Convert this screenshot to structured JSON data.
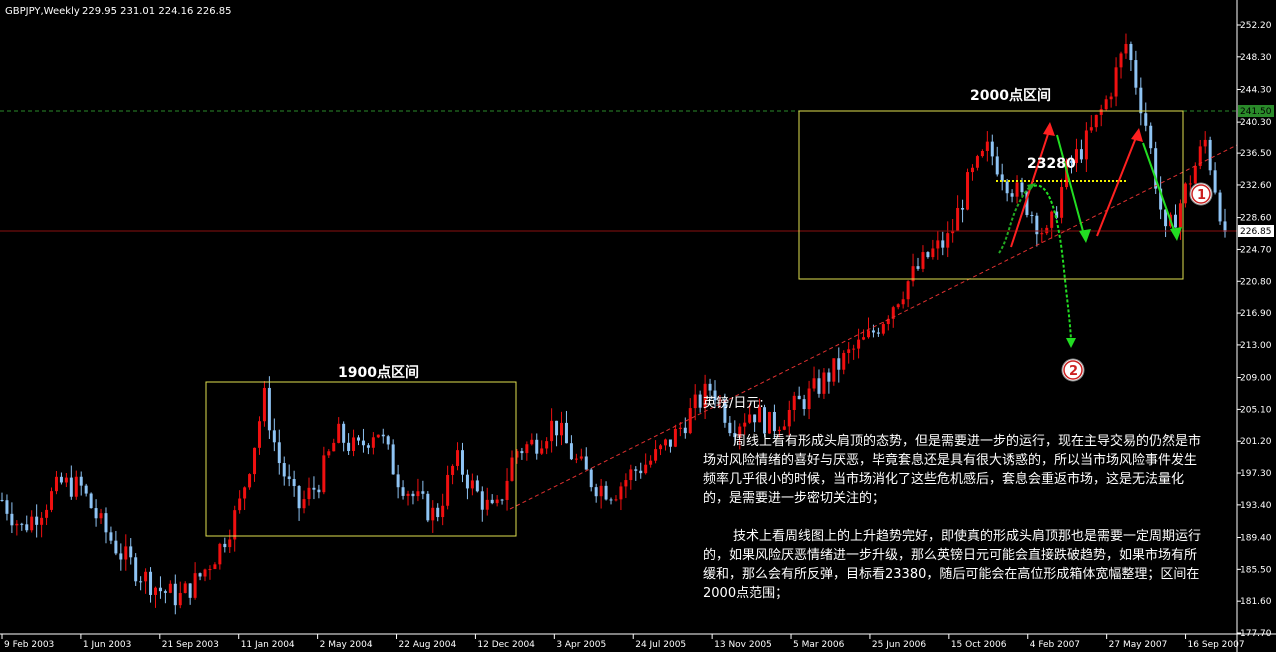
{
  "header": {
    "symbol": "GBPJPY,Weekly",
    "ohlc": "229.95 231.01 224.16 226.85"
  },
  "chart_data": {
    "type": "candlestick",
    "title": "GBPJPY,Weekly",
    "ylim": [
      177.7,
      252.2
    ],
    "y_ticks": [
      "252.20",
      "248.30",
      "244.30",
      "240.30",
      "236.50",
      "232.60",
      "228.60",
      "224.70",
      "220.80",
      "216.90",
      "213.00",
      "209.00",
      "205.10",
      "201.20",
      "197.30",
      "193.40",
      "189.40",
      "185.50",
      "181.60",
      "177.70"
    ],
    "x_ticks": [
      "9 Feb 2003",
      "1 Jun 2003",
      "21 Sep 2003",
      "11 Jan 2004",
      "2 May 2004",
      "22 Aug 2004",
      "12 Dec 2004",
      "3 Apr 2005",
      "24 Jul 2005",
      "13 Nov 2005",
      "5 Mar 2006",
      "25 Jun 2006",
      "15 Oct 2006",
      "4 Feb 2007",
      "27 May 2007",
      "16 Sep 2007"
    ],
    "x_start": "2003-02-09",
    "x_end": "2007-11-11",
    "current_price": {
      "label": "226.85",
      "value": 226.85
    },
    "marked_level": {
      "label": "241.50",
      "value": 241.5
    },
    "close_path": [
      [
        "2003-02-09",
        194.0
      ],
      [
        "2003-03-09",
        190.5
      ],
      [
        "2003-04-06",
        193.0
      ],
      [
        "2003-05-04",
        196.0
      ],
      [
        "2003-06-01",
        195.5
      ],
      [
        "2003-06-29",
        191.0
      ],
      [
        "2003-07-27",
        187.5
      ],
      [
        "2003-08-24",
        185.0
      ],
      [
        "2003-09-21",
        183.0
      ],
      [
        "2003-10-19",
        182.0
      ],
      [
        "2003-11-16",
        184.5
      ],
      [
        "2003-12-14",
        188.0
      ],
      [
        "2004-01-11",
        193.0
      ],
      [
        "2004-02-08",
        203.0
      ],
      [
        "2004-02-15",
        207.0
      ],
      [
        "2004-03-07",
        199.0
      ],
      [
        "2004-04-04",
        193.0
      ],
      [
        "2004-05-02",
        196.0
      ],
      [
        "2004-05-30",
        202.0
      ],
      [
        "2004-06-27",
        200.0
      ],
      [
        "2004-07-25",
        203.0
      ],
      [
        "2004-08-22",
        197.0
      ],
      [
        "2004-09-19",
        194.0
      ],
      [
        "2004-10-17",
        192.0
      ],
      [
        "2004-11-14",
        199.0
      ],
      [
        "2004-12-12",
        195.0
      ],
      [
        "2005-01-09",
        192.0
      ],
      [
        "2005-02-06",
        200.0
      ],
      [
        "2005-03-06",
        201.0
      ],
      [
        "2005-04-03",
        203.5
      ],
      [
        "2005-05-01",
        199.0
      ],
      [
        "2005-05-29",
        196.0
      ],
      [
        "2005-06-26",
        195.0
      ],
      [
        "2005-07-24",
        197.5
      ],
      [
        "2005-08-21",
        199.0
      ],
      [
        "2005-09-18",
        201.5
      ],
      [
        "2005-10-16",
        205.0
      ],
      [
        "2005-11-13",
        208.0
      ],
      [
        "2005-12-11",
        203.0
      ],
      [
        "2006-01-08",
        205.0
      ],
      [
        "2006-02-05",
        203.0
      ],
      [
        "2006-03-05",
        205.0
      ],
      [
        "2006-04-02",
        207.0
      ],
      [
        "2006-04-30",
        209.5
      ],
      [
        "2006-05-28",
        212.0
      ],
      [
        "2006-06-25",
        214.0
      ],
      [
        "2006-07-23",
        217.5
      ],
      [
        "2006-08-20",
        221.0
      ],
      [
        "2006-09-17",
        224.0
      ],
      [
        "2006-10-15",
        226.0
      ],
      [
        "2006-11-12",
        233.0
      ],
      [
        "2006-12-10",
        237.0
      ],
      [
        "2007-01-07",
        233.0
      ],
      [
        "2007-02-04",
        230.0
      ],
      [
        "2007-03-04",
        226.0
      ],
      [
        "2007-04-01",
        234.5
      ],
      [
        "2007-04-29",
        238.0
      ],
      [
        "2007-05-27",
        243.0
      ],
      [
        "2007-06-24",
        250.0
      ],
      [
        "2007-07-22",
        240.0
      ],
      [
        "2007-08-19",
        226.0
      ],
      [
        "2007-09-16",
        232.0
      ],
      [
        "2007-10-14",
        238.0
      ],
      [
        "2007-11-11",
        226.85
      ]
    ]
  },
  "annotations": {
    "box1_label": "1900点区间",
    "box2_label": "2000点区间",
    "target_label": "23280",
    "circle_1": "1",
    "circle_2": "2"
  },
  "commentary": {
    "heading": "英镑/日元:",
    "para1": "周线上看有形成头肩顶的态势，但是需要进一步的运行，现在主导交易的仍然是市场对风险情绪的喜好与厌恶，毕竟套息还是具有很大诱惑的，所以当市场风险事件发生频率几乎很小的时候，当市场消化了这些危机感后，套息会重返市场，这是无法量化的，是需要进一步密切关注的；",
    "para2": "技术上看周线图上的上升趋势完好，即使真的形成头肩顶那也是需要一定周期运行的，如果风险厌恶情绪进一步升级，那么英镑日元可能会直接跌破趋势，如果市场有所缓和，那么会有所反弹，目标看23380，随后可能会在高位形成箱体宽幅整理；区间在2000点范围；"
  },
  "colors": {
    "background": "#000000",
    "bull": "#f01010",
    "bear": "#8fc4f4",
    "box": "#e0e050",
    "trendline": "#e03030",
    "green_arrow": "#22dd22"
  }
}
